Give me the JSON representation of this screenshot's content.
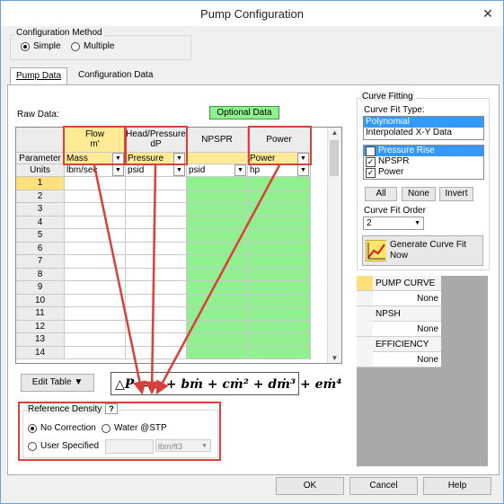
{
  "window": {
    "title": "Pump Configuration",
    "close": "✕"
  },
  "config_method": {
    "title": "Configuration Method",
    "options": [
      "Simple",
      "Multiple"
    ],
    "selected": "Simple"
  },
  "tabs": [
    {
      "label": "Pump Data",
      "active": true
    },
    {
      "label": "Configuration Data",
      "active": false
    }
  ],
  "raw_data_label": "Raw Data:",
  "optional_data": "Optional Data",
  "grid": {
    "columns": [
      {
        "header_line1": "Flow",
        "header_line2": "m'",
        "parameter": "Mass",
        "units": "lbm/sec"
      },
      {
        "header_line1": "Head/Pressure",
        "header_line2": "dP",
        "parameter": "Pressure",
        "units": "psid"
      },
      {
        "header_line1": "NPSPR",
        "header_line2": "",
        "parameter": "",
        "units": "psid"
      },
      {
        "header_line1": "Power",
        "header_line2": "",
        "parameter": "Power",
        "units": "hp"
      }
    ],
    "row_labels": {
      "parameter": "Parameter",
      "units": "Units"
    },
    "rows": [
      "1",
      "2",
      "3",
      "4",
      "5",
      "6",
      "7",
      "8",
      "9",
      "10",
      "11",
      "12",
      "13",
      "14"
    ]
  },
  "edit_table": {
    "label": "Edit Table"
  },
  "formula": {
    "text": "△P = a + bṁ + cṁ² + dṁ³ + eṁ⁴"
  },
  "reference_density": {
    "title": "Reference Density",
    "help": "?",
    "options": [
      "No Correction",
      "Water @STP",
      "User Specified"
    ],
    "selected": "No Correction",
    "units": "lbm/ft3"
  },
  "curve_fitting": {
    "title": "Curve Fitting",
    "fit_type_label": "Curve Fit Type:",
    "fit_types": [
      "Polynomial",
      "Interpolated X-Y Data"
    ],
    "selected_fit_type": "Polynomial",
    "curves": [
      {
        "label": "Pressure Rise",
        "checked": true,
        "selected": true
      },
      {
        "label": "NPSPR",
        "checked": true,
        "selected": false
      },
      {
        "label": "Power",
        "checked": true,
        "selected": false
      }
    ],
    "buttons": {
      "all": "All",
      "none": "None",
      "invert": "Invert"
    },
    "order_label": "Curve Fit Order",
    "order_value": "2",
    "generate_label": "Generate Curve Fit Now"
  },
  "curve_results": [
    {
      "name": "PUMP CURVE",
      "value": "None"
    },
    {
      "name": "NPSH",
      "value": "None"
    },
    {
      "name": "EFFICIENCY",
      "value": "None"
    }
  ],
  "footer": {
    "ok": "OK",
    "cancel": "Cancel",
    "help": "Help"
  },
  "colors": {
    "highlight": "#d9403a",
    "accent_yellow": "#ffea96",
    "green": "#90f090",
    "selection": "#3399ff"
  }
}
